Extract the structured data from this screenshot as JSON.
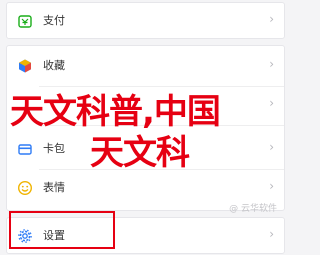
{
  "menu": {
    "pay": {
      "label": "支付",
      "icon": "wallet-icon",
      "icon_color": "#1aad19"
    },
    "favorites": {
      "label": "收藏",
      "icon": "cube-icon",
      "icon_color": "#2f7cf6"
    },
    "cards": {
      "label": "卡包",
      "icon": "card-icon",
      "icon_color": "#2f7cf6"
    },
    "emoji": {
      "label": "表情",
      "icon": "smiley-icon",
      "icon_color": "#f0b400"
    },
    "settings": {
      "label": "设置",
      "icon": "gear-icon",
      "icon_color": "#2f7cf6"
    }
  },
  "overlay": {
    "line1": "天文科普,中国",
    "line2": "天文科",
    "color": "#e60012"
  },
  "watermark": "@ 云华软件",
  "highlight_color": "#e60012"
}
